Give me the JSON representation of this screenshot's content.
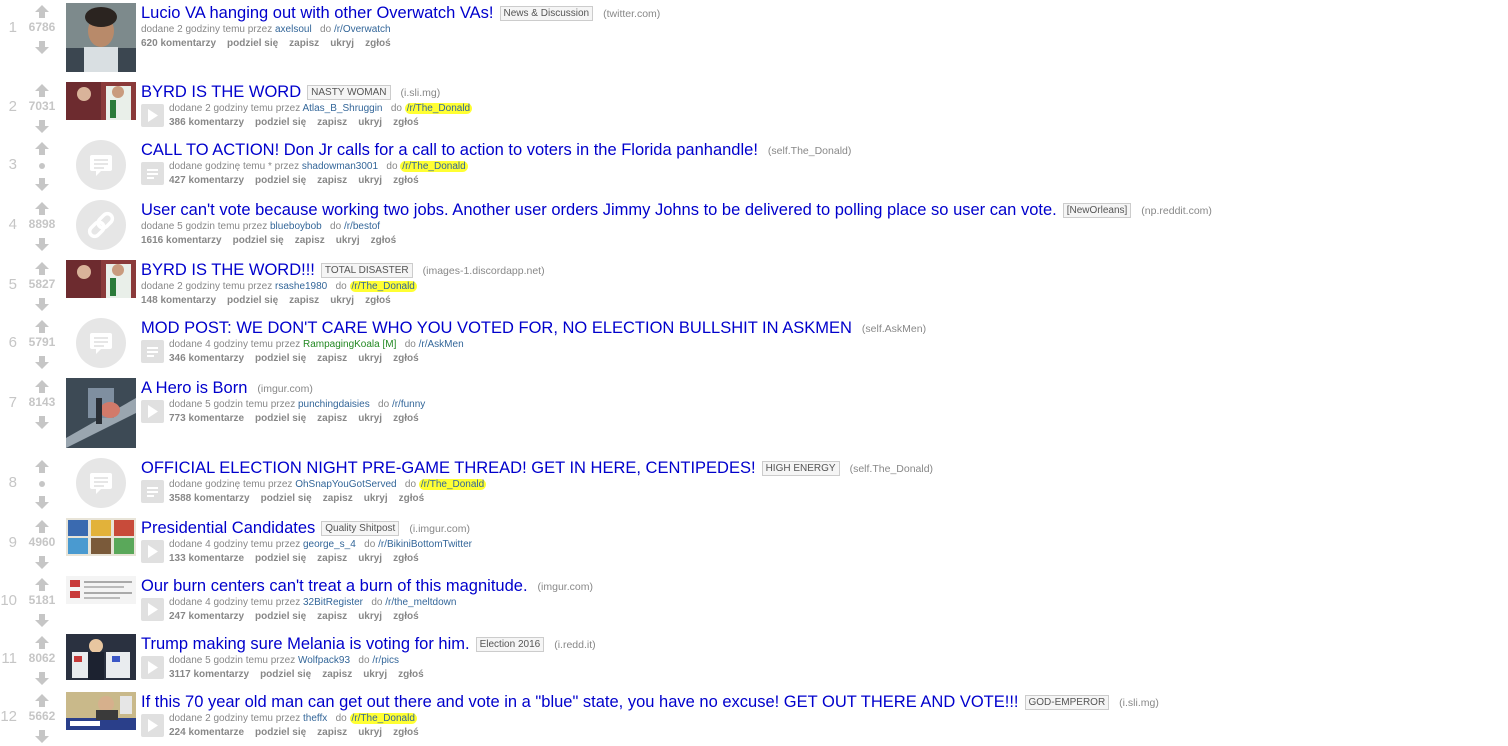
{
  "ui": {
    "submitted_by": "przez",
    "to": "do",
    "share": "podziel się",
    "save": "zapisz",
    "hide": "ukryj",
    "report": "zgłoś"
  },
  "posts": [
    {
      "rank": "1",
      "score": "6786",
      "title": "Lucio VA hanging out with other Overwatch VAs!",
      "flair": "News & Discussion",
      "domain": "(twitter.com)",
      "time": "dodane 2 godziny temu",
      "author": "axelsoul",
      "sub": "/r/Overwatch",
      "comments": "620 komentarzy",
      "thumb": "photo",
      "highlight": false
    },
    {
      "rank": "2",
      "score": "7031",
      "title": "BYRD IS THE WORD",
      "flair": "NASTY WOMAN",
      "domain": "(i.sli.mg)",
      "time": "dodane 2 godziny temu",
      "author": "Atlas_B_Shruggin",
      "sub": "/r/The_Donald",
      "comments": "386 komentarzy",
      "thumb": "photo",
      "highlight": true
    },
    {
      "rank": "3",
      "score": "",
      "title": "CALL TO ACTION! Don Jr calls for a call to action to voters in the Florida panhandle!",
      "flair": "",
      "domain": "(self.The_Donald)",
      "time": "dodane godzinę temu * ",
      "author": "shadowman3001",
      "sub": "/r/The_Donald",
      "comments": "427 komentarzy",
      "thumb": "self",
      "highlight": true
    },
    {
      "rank": "4",
      "score": "8898",
      "title": "User can't vote because working two jobs. Another user orders Jimmy Johns to be delivered to polling place so user can vote.",
      "flair": "[NewOrleans]",
      "domain": "(np.reddit.com)",
      "time": "dodane 5 godzin temu",
      "author": "blueboybob",
      "sub": "/r/bestof",
      "comments": "1616 komentarzy",
      "thumb": "link",
      "highlight": false
    },
    {
      "rank": "5",
      "score": "5827",
      "title": "BYRD IS THE WORD!!!",
      "flair": "TOTAL DISASTER",
      "domain": "(images-1.discordapp.net)",
      "time": "dodane 2 godziny temu",
      "author": "rsashe1980",
      "sub": "/r/The_Donald",
      "comments": "148 komentarzy",
      "thumb": "photo",
      "highlight": true
    },
    {
      "rank": "6",
      "score": "5791",
      "title": "MOD POST: WE DON'T CARE WHO YOU VOTED FOR, NO ELECTION BULLSHIT IN ASKMEN",
      "flair": "",
      "domain": "(self.AskMen)",
      "time": "dodane 4 godziny temu",
      "author": "RampagingKoala",
      "author_tag": "[M]",
      "sub": "/r/AskMen",
      "comments": "346 komentarzy",
      "thumb": "self",
      "highlight": false
    },
    {
      "rank": "7",
      "score": "8143",
      "title": "A Hero is Born",
      "flair": "",
      "domain": "(imgur.com)",
      "time": "dodane 5 godzin temu",
      "author": "punchingdaisies",
      "sub": "/r/funny",
      "comments": "773 komentarze",
      "thumb": "photo",
      "highlight": false
    },
    {
      "rank": "8",
      "score": "",
      "title": "OFFICIAL ELECTION NIGHT PRE-GAME THREAD! GET IN HERE, CENTIPEDES!",
      "flair": "HIGH ENERGY",
      "domain": "(self.The_Donald)",
      "time": "dodane godzinę temu",
      "author": "OhSnapYouGotServed",
      "sub": "/r/The_Donald",
      "comments": "3588 komentarzy",
      "thumb": "self",
      "highlight": true
    },
    {
      "rank": "9",
      "score": "4960",
      "title": "Presidential Candidates",
      "flair": "Quality Shitpost",
      "domain": "(i.imgur.com)",
      "time": "dodane 4 godziny temu",
      "author": "george_s_4",
      "sub": "/r/BikiniBottomTwitter",
      "comments": "133 komentarze",
      "thumb": "photo",
      "highlight": false
    },
    {
      "rank": "10",
      "score": "5181",
      "title": "Our burn centers can't treat a burn of this magnitude.",
      "flair": "",
      "domain": "(imgur.com)",
      "time": "dodane 4 godziny temu",
      "author": "32BitRegister",
      "sub": "/r/the_meltdown",
      "comments": "247 komentarzy",
      "thumb": "photo",
      "highlight": false
    },
    {
      "rank": "11",
      "score": "8062",
      "title": "Trump making sure Melania is voting for him.",
      "flair": "Election 2016",
      "domain": "(i.redd.it)",
      "time": "dodane 5 godzin temu",
      "author": "Wolfpack93",
      "sub": "/r/pics",
      "comments": "3117 komentarzy",
      "thumb": "photo",
      "highlight": false
    },
    {
      "rank": "12",
      "score": "5662",
      "title": "If this 70 year old man can get out there and vote in a \"blue\" state, you have no excuse! GET OUT THERE AND VOTE!!!",
      "flair": "GOD-EMPEROR",
      "domain": "(i.sli.mg)",
      "time": "dodane 2 godziny temu",
      "author": "theffx",
      "sub": "/r/The_Donald",
      "comments": "224 komentarze",
      "thumb": "photo",
      "highlight": true
    }
  ]
}
